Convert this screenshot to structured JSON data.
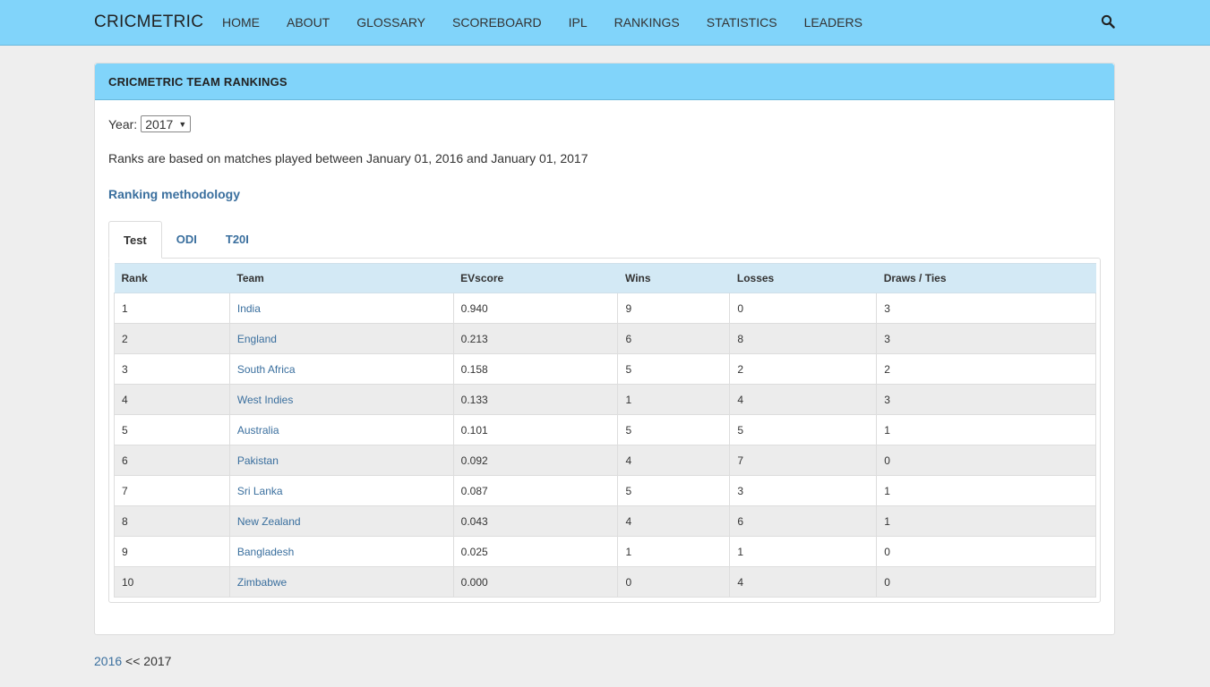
{
  "navbar": {
    "brand": "CRICMETRIC",
    "items": [
      "HOME",
      "ABOUT",
      "GLOSSARY",
      "SCOREBOARD",
      "IPL",
      "RANKINGS",
      "STATISTICS",
      "LEADERS"
    ],
    "search_icon": "search-icon"
  },
  "panel": {
    "title": "CRICMETRIC TEAM RANKINGS",
    "year_label": "Year:",
    "year_value": "2017",
    "ranks_note": "Ranks are based on matches played between January 01, 2016 and January 01, 2017",
    "methodology_link": "Ranking methodology",
    "tabs": [
      {
        "label": "Test",
        "active": true
      },
      {
        "label": "ODI",
        "active": false
      },
      {
        "label": "T20I",
        "active": false
      }
    ]
  },
  "table": {
    "headers": [
      "Rank",
      "Team",
      "EVscore",
      "Wins",
      "Losses",
      "Draws / Ties"
    ],
    "rows": [
      [
        "1",
        "India",
        "0.940",
        "9",
        "0",
        "3"
      ],
      [
        "2",
        "England",
        "0.213",
        "6",
        "8",
        "3"
      ],
      [
        "3",
        "South Africa",
        "0.158",
        "5",
        "2",
        "2"
      ],
      [
        "4",
        "West Indies",
        "0.133",
        "1",
        "4",
        "3"
      ],
      [
        "5",
        "Australia",
        "0.101",
        "5",
        "5",
        "1"
      ],
      [
        "6",
        "Pakistan",
        "0.092",
        "4",
        "7",
        "0"
      ],
      [
        "7",
        "Sri Lanka",
        "0.087",
        "5",
        "3",
        "1"
      ],
      [
        "8",
        "New Zealand",
        "0.043",
        "4",
        "6",
        "1"
      ],
      [
        "9",
        "Bangladesh",
        "0.025",
        "1",
        "1",
        "0"
      ],
      [
        "10",
        "Zimbabwe",
        "0.000",
        "0",
        "4",
        "0"
      ]
    ]
  },
  "footer": {
    "prev_year": "2016",
    "separator": "<<",
    "current_year": "2017"
  },
  "colors": {
    "navbar_bg": "#81d4fa",
    "link": "#3a6f9e",
    "table_header_bg": "#d3e9f5"
  }
}
